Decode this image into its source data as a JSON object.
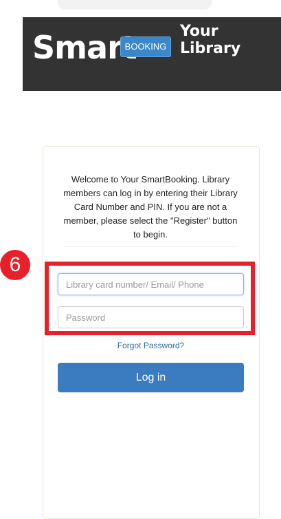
{
  "header": {
    "logo_smart": "Smart",
    "logo_booking": "BOOKING",
    "logo_your": "Your",
    "logo_library": "Library"
  },
  "intro": {
    "text": "Welcome to Your SmartBooking. Library members can log in by entering their Library Card Number and PIN. If you are not a member, please select the \"Register\" button to begin."
  },
  "annotation": {
    "step_number": "6",
    "color": "#e8202a"
  },
  "login_form": {
    "username_placeholder": "Library card number/ Email/ Phone",
    "username_value": "",
    "password_placeholder": "Password",
    "password_value": "",
    "forgot_label": "Forgot Password?",
    "login_label": "Log in"
  },
  "colors": {
    "banner": "#333333",
    "booking_badge": "#3a87cc",
    "primary_button": "#3b7bbf",
    "link": "#2a6fa8"
  }
}
